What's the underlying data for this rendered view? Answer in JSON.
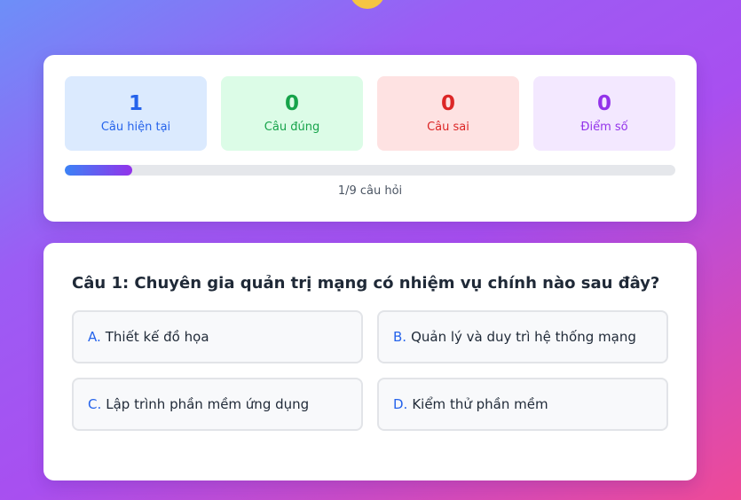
{
  "stats": {
    "current": {
      "value": "1",
      "label": "Câu hiện tại"
    },
    "correct": {
      "value": "0",
      "label": "Câu đúng"
    },
    "wrong": {
      "value": "0",
      "label": "Câu sai"
    },
    "score": {
      "value": "0",
      "label": "Điểm số"
    }
  },
  "progress": {
    "fraction": 0.111,
    "text": "1/9 câu hỏi"
  },
  "question": {
    "title": "Câu 1: Chuyên gia quản trị mạng có nhiệm vụ chính nào sau đây?",
    "options": [
      {
        "letter": "A.",
        "text": "Thiết kế đồ họa"
      },
      {
        "letter": "B.",
        "text": "Quản lý và duy trì hệ thống mạng"
      },
      {
        "letter": "C.",
        "text": "Lập trình phần mềm ứng dụng"
      },
      {
        "letter": "D.",
        "text": "Kiểm thử phần mềm"
      }
    ]
  },
  "colors": {
    "blue": "#2563eb",
    "green": "#16a34a",
    "red": "#dc2626",
    "purple": "#9333ea"
  }
}
